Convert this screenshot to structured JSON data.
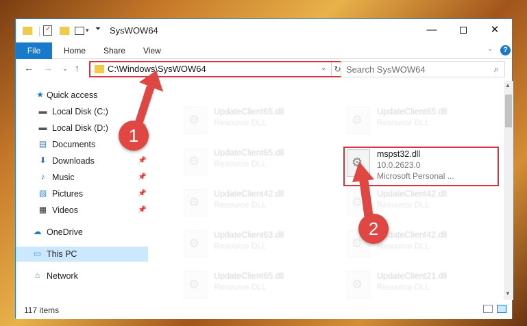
{
  "window": {
    "title": "SysWOW64",
    "controls": {
      "minimize": "—",
      "maximize": "",
      "close": "✕"
    }
  },
  "ribbon": {
    "tabs": [
      "File",
      "Home",
      "Share",
      "View"
    ],
    "help": "?",
    "expand": "⌄"
  },
  "nav": {
    "back": "←",
    "forward": "→",
    "recent": "⌄",
    "up": "↑",
    "address": "C:\\Windows\\SysWOW64",
    "address_dropdown": "⌄",
    "refresh": "↻",
    "search_placeholder": "Search SysWOW64",
    "search_icon": "⌕"
  },
  "sidebar": {
    "items": [
      {
        "label": "Quick access",
        "icon": "star-icon"
      },
      {
        "label": "Local Disk (C:)",
        "icon": "drive-icon",
        "pinned": true
      },
      {
        "label": "Local Disk (D:)",
        "icon": "drive-icon",
        "pinned": true
      },
      {
        "label": "Documents",
        "icon": "documents-icon",
        "pinned": true
      },
      {
        "label": "Downloads",
        "icon": "downloads-icon",
        "pinned": true
      },
      {
        "label": "Music",
        "icon": "music-icon",
        "pinned": true
      },
      {
        "label": "Pictures",
        "icon": "pictures-icon",
        "pinned": true
      },
      {
        "label": "Videos",
        "icon": "videos-icon",
        "pinned": true
      },
      {
        "label": "OneDrive",
        "icon": "onedrive-icon"
      },
      {
        "label": "This PC",
        "icon": "computer-icon",
        "selected": true
      },
      {
        "label": "Network",
        "icon": "network-icon"
      }
    ]
  },
  "files": {
    "left": [
      {
        "name": "UpdateClient65.dll",
        "type": "Resource DLL"
      },
      {
        "name": "UpdateClient65.dll",
        "type": "Resource DLL"
      },
      {
        "name": "UpdateClient42.dll",
        "type": "Resource DLL"
      },
      {
        "name": "UpdateClient63.dll",
        "type": "Resource DLL"
      },
      {
        "name": "UpdateClient65.dll",
        "type": "Resource DLL"
      }
    ],
    "right": [
      {
        "name": "UpdateClient65.dll",
        "type": "Resource DLL"
      },
      {
        "name": "mspst32.dll",
        "version": "10.0.2623.0",
        "type": "Microsoft Personal ...",
        "highlighted": true
      },
      {
        "name": "UpdateClient42.dll",
        "type": "Resource DLL"
      },
      {
        "name": "UpdateClient42.dll",
        "type": "Resource DLL"
      },
      {
        "name": "UpdateClient21.dll",
        "type": "Resource DLL"
      }
    ]
  },
  "status": {
    "count": "117 items"
  },
  "annotations": {
    "step1": "1",
    "step2": "2",
    "color": "#e04743"
  }
}
